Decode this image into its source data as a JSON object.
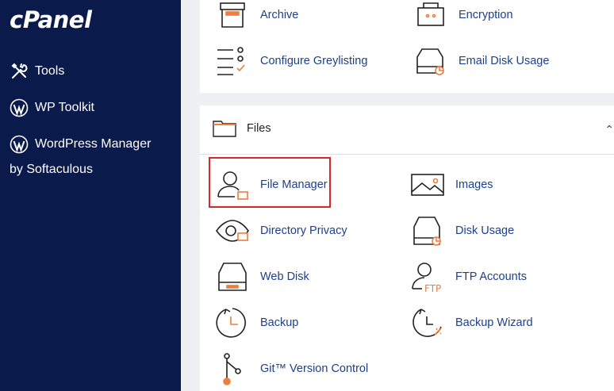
{
  "brand": {
    "logo": "cPanel"
  },
  "sidebar": {
    "items": [
      {
        "label": "Tools",
        "icon": "tools-icon"
      },
      {
        "label": "WP Toolkit",
        "icon": "wordpress-icon"
      },
      {
        "label": "WordPress Manager",
        "icon": "wordpress-icon",
        "sublabel": "by Softaculous"
      }
    ]
  },
  "email_section": {
    "items": [
      {
        "label": "Archive",
        "icon": "archive-icon"
      },
      {
        "label": "Encryption",
        "icon": "encryption-icon"
      },
      {
        "label": "Configure Greylisting",
        "icon": "greylisting-icon"
      },
      {
        "label": "Email Disk Usage",
        "icon": "email-disk-usage-icon"
      }
    ]
  },
  "files_section": {
    "title": "Files",
    "items": [
      {
        "label": "File Manager",
        "icon": "file-manager-icon",
        "highlighted": true
      },
      {
        "label": "Images",
        "icon": "images-icon"
      },
      {
        "label": "Directory Privacy",
        "icon": "directory-privacy-icon"
      },
      {
        "label": "Disk Usage",
        "icon": "disk-usage-icon"
      },
      {
        "label": "Web Disk",
        "icon": "web-disk-icon"
      },
      {
        "label": "FTP Accounts",
        "icon": "ftp-accounts-icon"
      },
      {
        "label": "Backup",
        "icon": "backup-icon"
      },
      {
        "label": "Backup Wizard",
        "icon": "backup-wizard-icon"
      },
      {
        "label": "Git™ Version Control",
        "icon": "git-icon"
      }
    ]
  },
  "colors": {
    "sidebar": "#0a1a4a",
    "link": "#1e3f8a",
    "accent": "#f07c3e",
    "highlight": "#d9262b"
  }
}
